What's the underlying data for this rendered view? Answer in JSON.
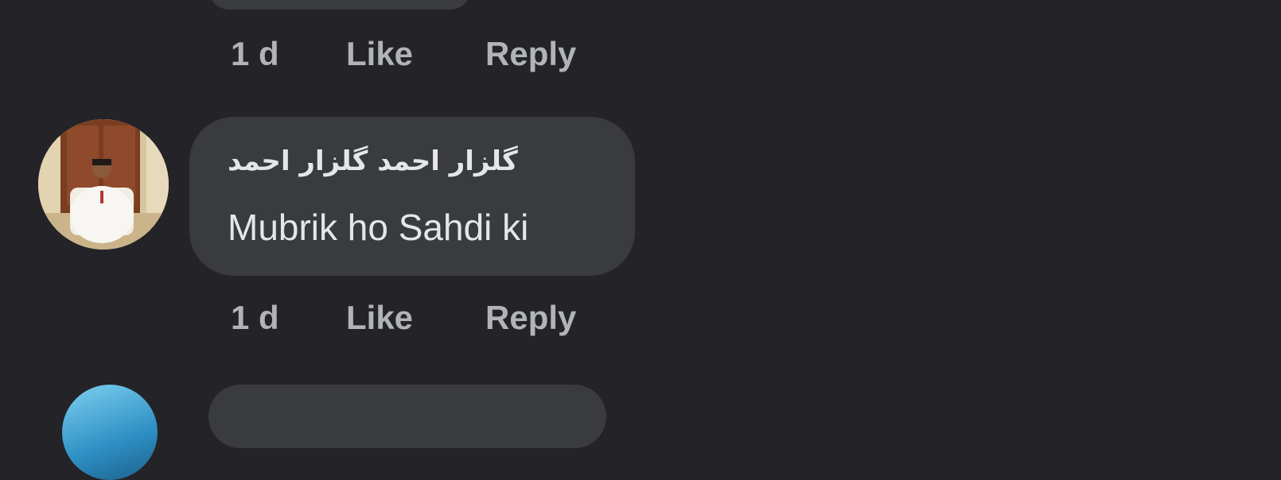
{
  "comments": [
    {
      "time": "1 d",
      "like_label": "Like",
      "reply_label": "Reply"
    },
    {
      "author": "گلزار احمد گلزار احمد",
      "text": "Mubrik ho Sahdi ki",
      "time": "1 d",
      "like_label": "Like",
      "reply_label": "Reply"
    }
  ],
  "colors": {
    "background": "#242328",
    "bubble": "#3a3b3c",
    "primary_text": "#e4e6eb",
    "secondary_text": "#b0b3b8"
  }
}
